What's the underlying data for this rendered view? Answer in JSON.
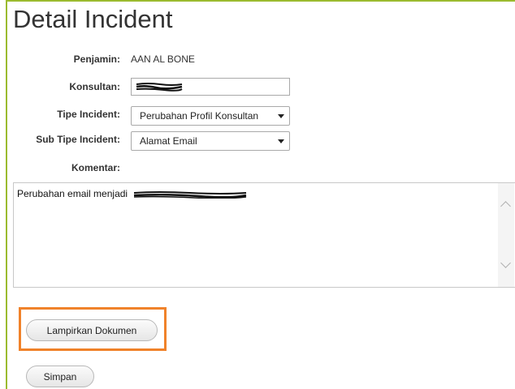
{
  "page": {
    "title": "Detail Incident"
  },
  "form": {
    "penjamin_label": "Penjamin:",
    "penjamin_value": "AAN AL BONE",
    "konsultan_label": "Konsultan:",
    "tipe_label": "Tipe Incident:",
    "tipe_value": "Perubahan Profil Konsultan",
    "subtipe_label": "Sub Tipe Incident:",
    "subtipe_value": "Alamat Email",
    "komentar_label": "Komentar:",
    "komentar_text": "Perubahan email menjadi"
  },
  "buttons": {
    "lampirkan": "Lampirkan Dokumen",
    "simpan": "Simpan"
  },
  "colors": {
    "frame": "#9bbb2f",
    "highlight": "#f0822a"
  }
}
